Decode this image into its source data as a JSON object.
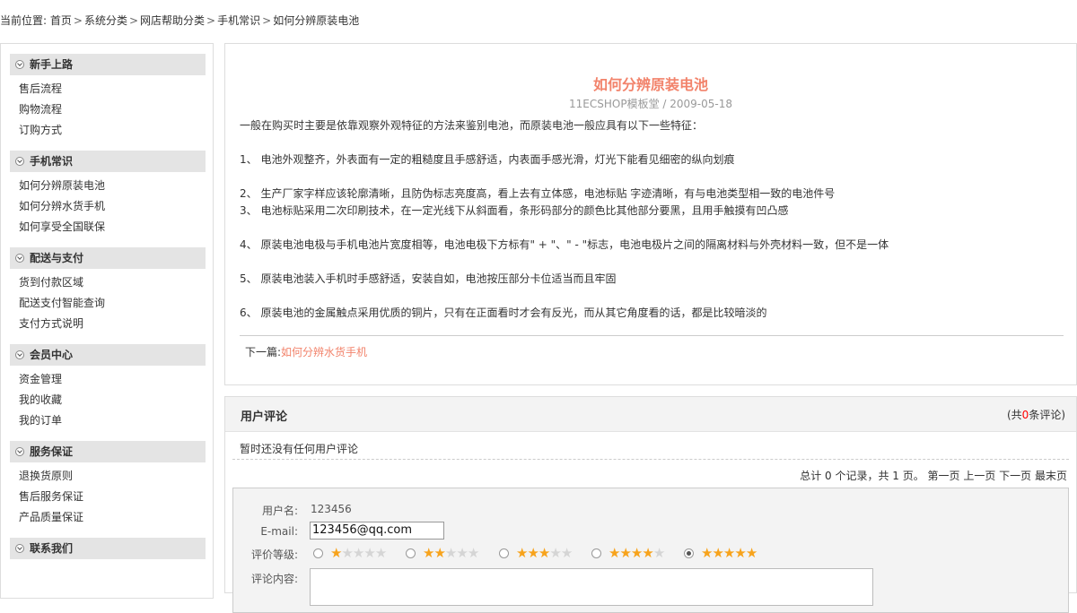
{
  "breadcrumb": {
    "prefix": "当前位置:",
    "items": [
      "首页",
      "系统分类",
      "网店帮助分类",
      "手机常识",
      "如何分辨原装电池"
    ],
    "separator": ">"
  },
  "sidebar": [
    {
      "title": "新手上路",
      "items": [
        "售后流程",
        "购物流程",
        "订购方式"
      ]
    },
    {
      "title": "手机常识",
      "items": [
        "如何分辨原装电池",
        "如何分辨水货手机",
        "如何享受全国联保"
      ]
    },
    {
      "title": "配送与支付",
      "items": [
        "货到付款区域",
        "配送支付智能查询",
        "支付方式说明"
      ]
    },
    {
      "title": "会员中心",
      "items": [
        "资金管理",
        "我的收藏",
        "我的订单"
      ]
    },
    {
      "title": "服务保证",
      "items": [
        "退换货原则",
        "售后服务保证",
        "产品质量保证"
      ]
    },
    {
      "title": "联系我们",
      "items": []
    }
  ],
  "article": {
    "title": "如何分辨原装电池",
    "meta": "11ECSHOP模板堂 / 2009-05-18",
    "paragraphs": [
      "一般在购买时主要是依靠观察外观特征的方法来鉴别电池，而原装电池一般应具有以下一些特征：",
      "",
      "1、 电池外观整齐，外表面有一定的粗糙度且手感舒适，内表面手感光滑，灯光下能看见细密的纵向划痕",
      "",
      "2、 生产厂家字样应该轮廓清晰，且防伪标志亮度高，看上去有立体感，电池标贴 字迹清晰，有与电池类型相一致的电池件号",
      "3、 电池标贴采用二次印刷技术，在一定光线下从斜面看，条形码部分的颜色比其他部分要黑，且用手触摸有凹凸感",
      "",
      "4、 原装电池电极与手机电池片宽度相等，电池电极下方标有\" + \"、\" - \"标志，电池电极片之间的隔离材料与外壳材料一致，但不是一体",
      "",
      "5、 原装电池装入手机时手感舒适，安装自如，电池按压部分卡位适当而且牢固",
      "",
      "6、 原装电池的金属触点采用优质的铜片，只有在正面看时才会有反光，而从其它角度看的话，都是比较暗淡的"
    ],
    "next_label": "下一篇:",
    "next_link": "如何分辨水货手机"
  },
  "comments": {
    "title": "用户评论",
    "count_prefix": "(共",
    "count": "0",
    "count_suffix": "条评论)",
    "empty_text": "暂时还没有任何用户评论",
    "pager": "总计 0 个记录，共 1 页。 第一页 上一页 下一页 最末页",
    "form": {
      "username_label": "用户名:",
      "username_value": "123456",
      "email_label": "E-mail:",
      "email_value": "123456@qq.com",
      "rank_label": "评价等级:",
      "ranks": [
        1,
        2,
        3,
        4,
        5
      ],
      "selected_rank": 5,
      "content_label": "评论内容:"
    }
  },
  "colors": {
    "accent": "#f2836b",
    "star": "#f7a31c",
    "count": "#ff0000"
  }
}
